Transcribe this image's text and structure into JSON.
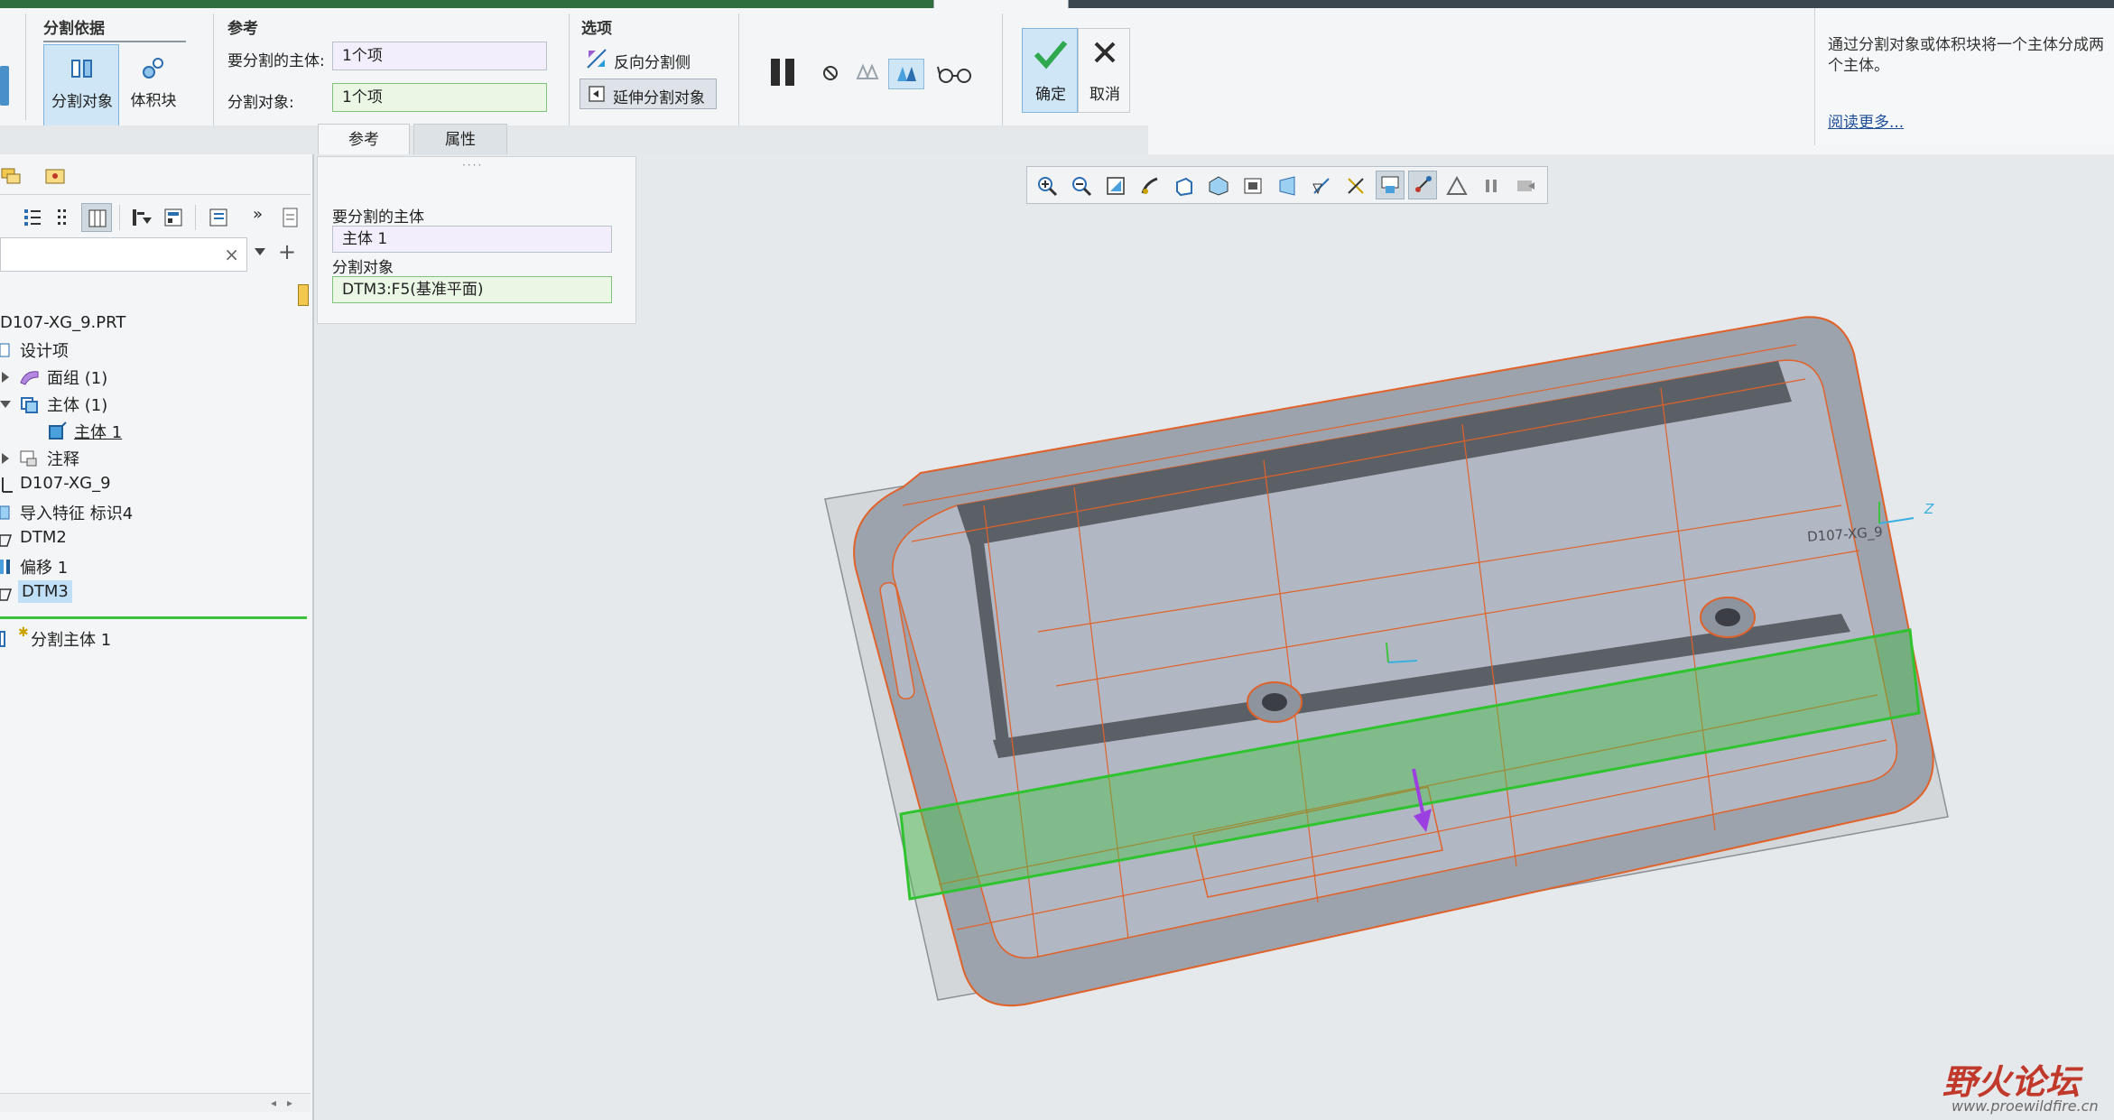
{
  "ribbon": {
    "split_basis": {
      "title": "分割依据",
      "split_object_label": "分割对象",
      "volume_block_label": "体积块"
    },
    "reference": {
      "title": "参考",
      "body_to_split_label": "要分割的主体:",
      "body_to_split_value": "1个项",
      "split_object_label": "分割对象:",
      "split_object_value": "1个项"
    },
    "options": {
      "title": "选项",
      "reverse_side_label": "反向分割侧",
      "extend_object_label": "延伸分割对象"
    },
    "tabs": [
      "参考",
      "属性"
    ],
    "confirm_label": "确定",
    "cancel_label": "取消"
  },
  "info": {
    "text": "通过分割对象或体积块将一个主体分成两个主体。",
    "link": "阅读更多..."
  },
  "ref_panel": {
    "body_label": "要分割的主体",
    "body_value": "主体 1",
    "object_label": "分割对象",
    "object_value": "DTM3:F5(基准平面)"
  },
  "tree": {
    "root": "D107-XG_9.PRT",
    "items": [
      {
        "label": "设计项",
        "indent": 0
      },
      {
        "label": "面组 (1)",
        "indent": 1
      },
      {
        "label": "主体 (1)",
        "indent": 1
      },
      {
        "label": "主体 1",
        "indent": 2
      },
      {
        "label": "注释",
        "indent": 1
      },
      {
        "label": "D107-XG_9",
        "indent": 0
      },
      {
        "label": "导入特征 标识4",
        "indent": 0
      },
      {
        "label": "DTM2",
        "indent": 0
      },
      {
        "label": "偏移 1",
        "indent": 0
      },
      {
        "label": "DTM3",
        "indent": 0
      }
    ],
    "insert_item": "分割主体 1"
  },
  "viewport": {
    "csys_label": "D107-XG_9",
    "axis_label": "Z"
  },
  "watermark": {
    "text": "野火论坛",
    "url": "www.proewildfire.cn"
  },
  "colors": {
    "accent_green": "#2fa84f",
    "model_edges": "#e0622a",
    "split_plane": "#3ec23e",
    "selection_blue": "#cfe6f7"
  }
}
